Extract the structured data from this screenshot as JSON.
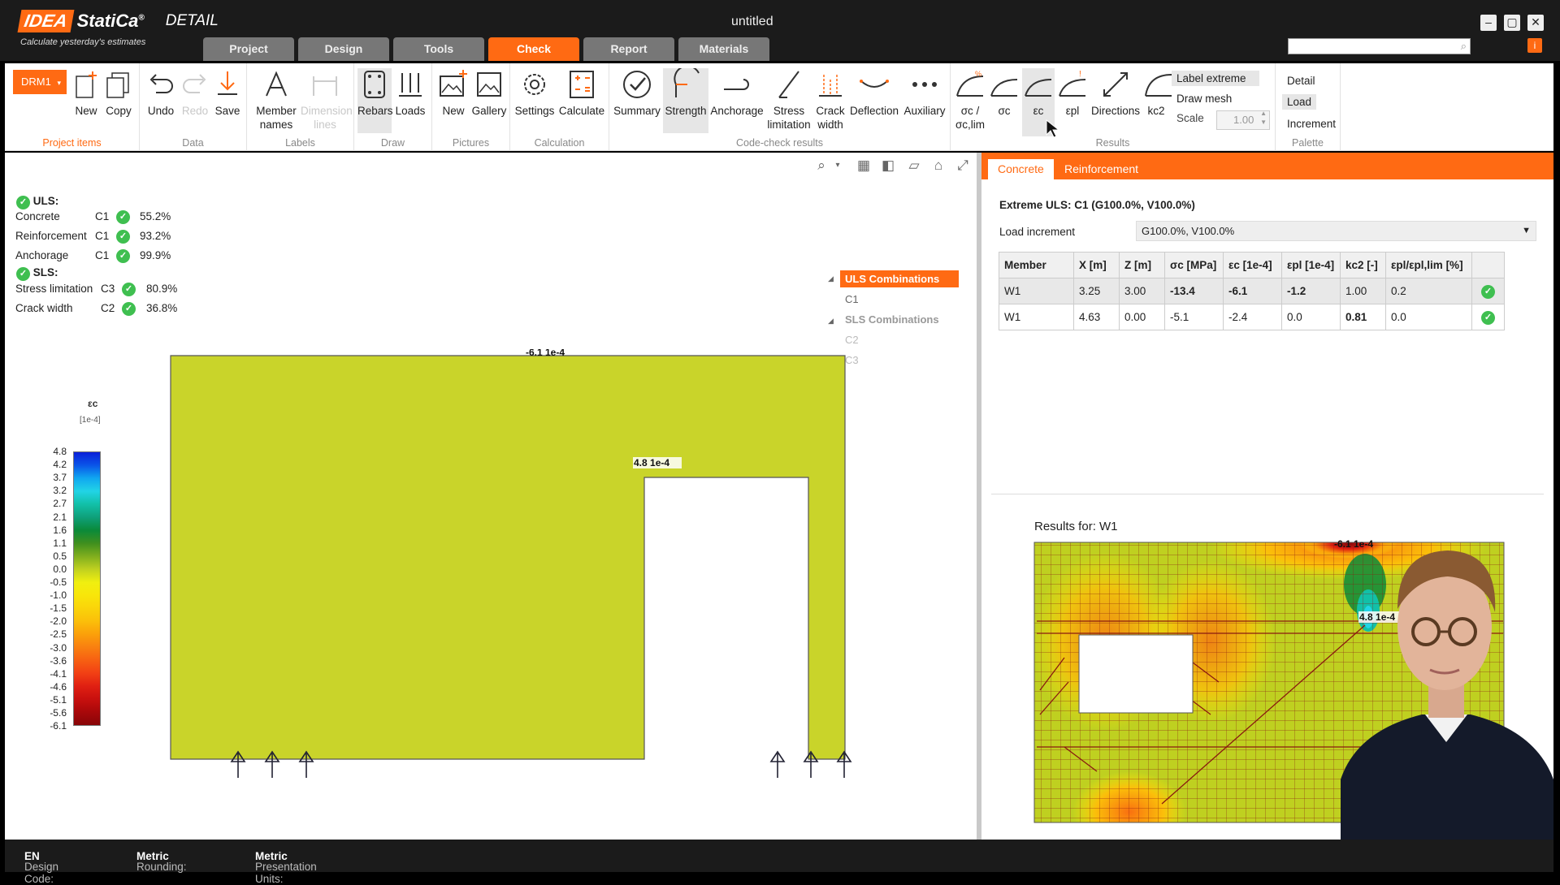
{
  "app": {
    "brand_box": "IDEA",
    "brand_name": "StatiCa",
    "brand_reg": "®",
    "product": "DETAIL",
    "slogan": "Calculate yesterday's estimates",
    "window_title": "untitled"
  },
  "main_tabs": [
    {
      "label": "Project"
    },
    {
      "label": "Design"
    },
    {
      "label": "Tools"
    },
    {
      "label": "Check"
    },
    {
      "label": "Report"
    },
    {
      "label": "Materials"
    }
  ],
  "active_tab": "Check",
  "ribbon": {
    "project_items": {
      "dropdown": "DRM1",
      "new": "New",
      "copy": "Copy",
      "label": "Project items"
    },
    "data": {
      "undo": "Undo",
      "redo": "Redo",
      "save": "Save",
      "label": "Data"
    },
    "labels": {
      "member_names_1": "Member",
      "member_names_2": "names",
      "dim_1": "Dimension",
      "dim_2": "lines",
      "label": "Labels"
    },
    "draw": {
      "rebars": "Rebars",
      "loads": "Loads",
      "label": "Draw"
    },
    "pictures": {
      "new": "New",
      "gallery": "Gallery",
      "label": "Pictures"
    },
    "calculation": {
      "settings": "Settings",
      "calculate": "Calculate",
      "label": "Calculation"
    },
    "code_check": {
      "summary": "Summary",
      "strength": "Strength",
      "anchorage": "Anchorage",
      "stress_1": "Stress",
      "stress_2": "limitation",
      "crack_1": "Crack",
      "crack_2": "width",
      "deflection": "Deflection",
      "auxiliary": "Auxiliary",
      "label": "Code-check results"
    },
    "results": {
      "sc_lim_1": "σc /",
      "sc_lim_2": "σc,lim",
      "sc": "σc",
      "ec": "εc",
      "epl": "εpl",
      "directions": "Directions",
      "kc2": "kc2",
      "label_extreme": "Label extreme",
      "draw_mesh": "Draw mesh",
      "scale_label": "Scale",
      "scale_value": "1.00",
      "label": "Results"
    },
    "palette": {
      "detail": "Detail",
      "load": "Load",
      "increment": "Increment",
      "label": "Palette"
    }
  },
  "summary": {
    "uls_label": "ULS:",
    "uls": [
      {
        "name": "Concrete",
        "comb": "C1",
        "value": "55.2%"
      },
      {
        "name": "Reinforcement",
        "comb": "C1",
        "value": "93.2%"
      },
      {
        "name": "Anchorage",
        "comb": "C1",
        "value": "99.9%"
      }
    ],
    "sls_label": "SLS:",
    "sls": [
      {
        "name": "Stress limitation",
        "comb": "C3",
        "value": "80.9%"
      },
      {
        "name": "Crack width",
        "comb": "C2",
        "value": "36.8%"
      }
    ]
  },
  "tree": {
    "uls_comb": "ULS Combinations",
    "c1": "C1",
    "sls_comb": "SLS Combinations",
    "c2": "C2",
    "c3": "C3"
  },
  "legend": {
    "title": "εc",
    "unit": "[1e-4]",
    "ticks": [
      "4.8",
      "4.2",
      "3.7",
      "3.2",
      "2.7",
      "2.1",
      "1.6",
      "1.1",
      "0.5",
      "0.0",
      "-0.5",
      "-1.0",
      "-1.5",
      "-2.0",
      "-2.5",
      "-3.0",
      "-3.6",
      "-4.1",
      "-4.6",
      "-5.1",
      "-5.6",
      "-6.1"
    ],
    "colors": [
      "#0a1fd8",
      "#0a55e8",
      "#10a7f0",
      "#22d4e6",
      "#12c0a8",
      "#0fa07a",
      "#0a8a3a",
      "#3f8f1e",
      "#7fae1e",
      "#bfd020",
      "#f0ef10",
      "#f8e60a",
      "#fad40a",
      "#fbbf0a",
      "#fba00a",
      "#f98010",
      "#f76012",
      "#f24014",
      "#e02012",
      "#c8100e",
      "#a8080a",
      "#880508"
    ]
  },
  "model_labels": {
    "min": "-6.1 1e-4",
    "max": "4.8 1e-4"
  },
  "right_tabs": {
    "concrete": "Concrete",
    "reinforcement": "Reinforcement"
  },
  "extreme_title": "Extreme ULS: C1 (G100.0%, V100.0%)",
  "load_increment": {
    "label": "Load increment",
    "value": "G100.0%, V100.0%"
  },
  "table": {
    "headers": [
      "Member",
      "X [m]",
      "Z [m]",
      "σc [MPa]",
      "εc [1e-4]",
      "εpl [1e-4]",
      "kc2 [-]",
      "εpl/εpl,lim [%]"
    ],
    "rows": [
      [
        "W1",
        "3.25",
        "3.00",
        "-13.4",
        "-6.1",
        "-1.2",
        "1.00",
        "0.2"
      ],
      [
        "W1",
        "4.63",
        "0.00",
        "-5.1",
        "-2.4",
        "0.0",
        "0.81",
        "0.0"
      ]
    ]
  },
  "results_for": "Results for: W1",
  "status": {
    "design_code_label": "Design Code:",
    "design_code": "EN",
    "rounding_label": "Rounding:",
    "rounding": "Metric",
    "units_label": "Presentation Units:",
    "units": "Metric"
  },
  "colors": {
    "accent": "#ff6a13",
    "ok": "#3fbf50",
    "titlebar": "#1b1b1b"
  }
}
